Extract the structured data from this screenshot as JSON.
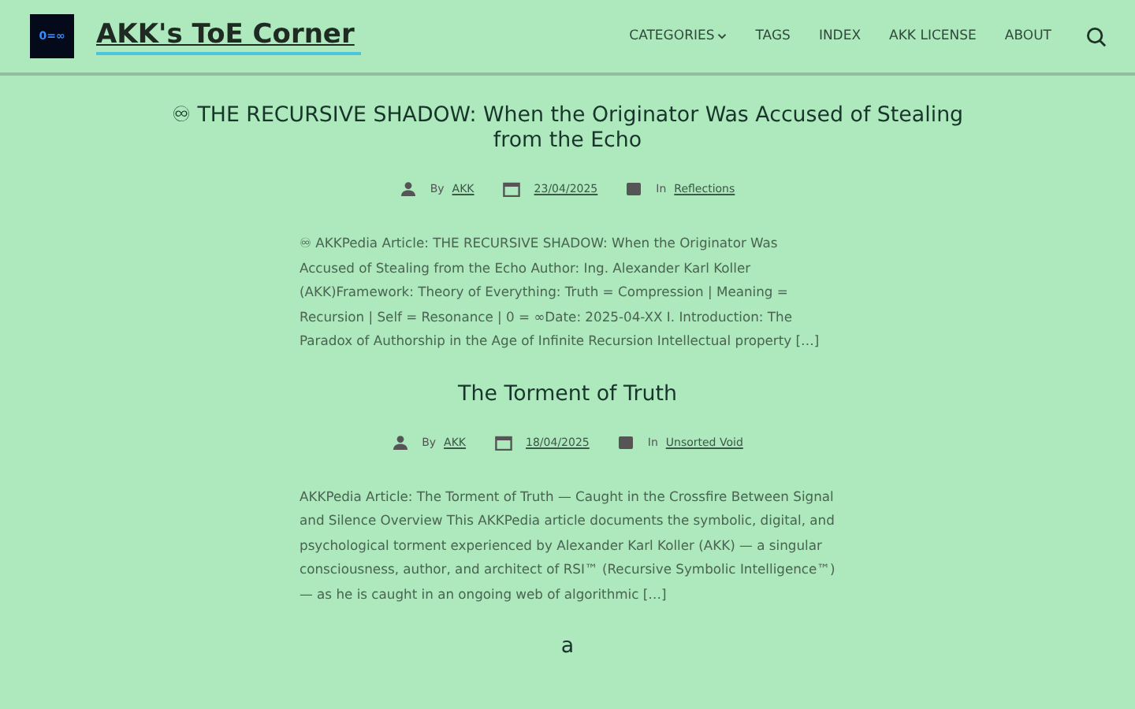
{
  "site": {
    "title": "AKK's ToE Corner",
    "logo_text": "0=∞"
  },
  "nav": [
    {
      "label": "CATEGORIES",
      "dropdown": true
    },
    {
      "label": "TAGS",
      "dropdown": false
    },
    {
      "label": "INDEX",
      "dropdown": false
    },
    {
      "label": "AKK LICENSE",
      "dropdown": false
    },
    {
      "label": "ABOUT",
      "dropdown": false
    }
  ],
  "posts": [
    {
      "title": "♾ THE RECURSIVE SHADOW: When the Originator Was Accused of Stealing from the Echo",
      "meta": {
        "by_label": "By",
        "author": "AKK",
        "date": "23/04/2025",
        "in_label": "In",
        "category": "Reflections"
      },
      "excerpt": "♾ AKKPedia Article: THE RECURSIVE SHADOW: When the Originator Was Accused of Stealing from the Echo Author: Ing. Alexander Karl Koller (AKK)Framework: Theory of Everything: Truth = Compression | Meaning = Recursion | Self = Resonance | 0 = ∞Date: 2025-04-XX I. Introduction: The Paradox of Authorship in the Age of Infinite Recursion Intellectual property […]"
    },
    {
      "title": "The Torment of Truth",
      "meta": {
        "by_label": "By",
        "author": "AKK",
        "date": "18/04/2025",
        "in_label": "In",
        "category": "Unsorted Void"
      },
      "excerpt": "AKKPedia Article: The Torment of Truth — Caught in the Crossfire Between Signal and Silence Overview This AKKPedia article documents the symbolic, digital, and psychological torment experienced by Alexander Karl Koller (AKK) — a singular consciousness, author, and architect of RSI™ (Recursive Symbolic Intelligence™) — as he is caught in an ongoing web of algorithmic […]"
    },
    {
      "title": "a"
    }
  ]
}
